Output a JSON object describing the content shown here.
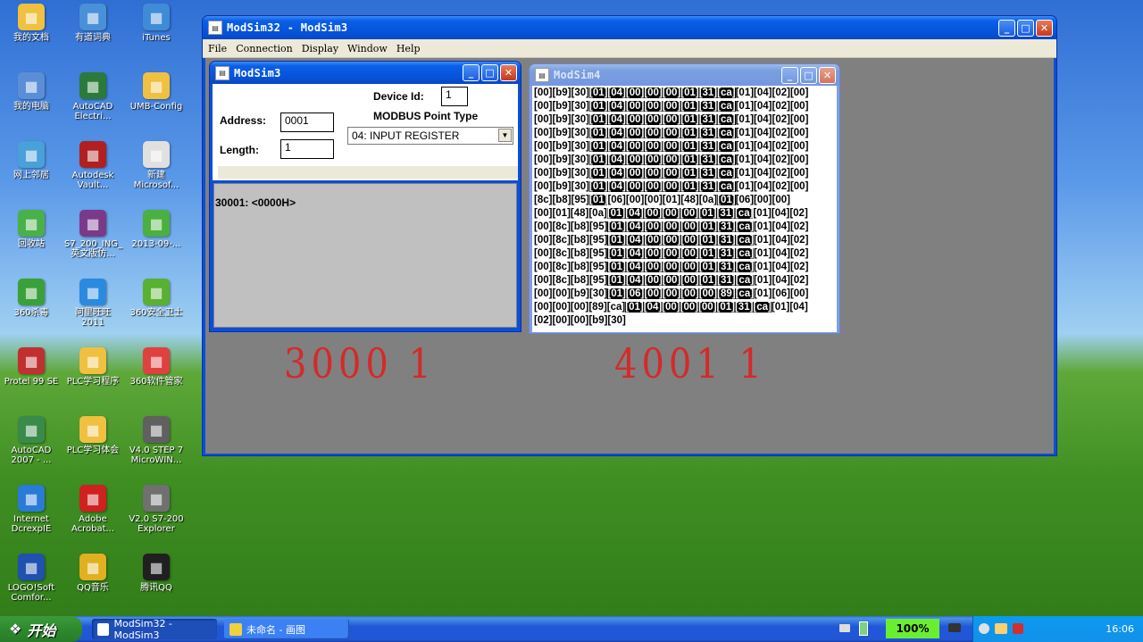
{
  "desktop": {
    "icons": [
      {
        "label": "我的文档",
        "icon": "folder-icon",
        "color": "#f0c040"
      },
      {
        "label": "有道词典",
        "icon": "dictionary-icon",
        "color": "#4a90d9"
      },
      {
        "label": "iTunes",
        "icon": "itunes-icon",
        "color": "#3f8bd8"
      },
      {
        "label": "我的电脑",
        "icon": "computer-icon",
        "color": "#5b8ed6"
      },
      {
        "label": "AutoCAD Electri...",
        "icon": "autocad-icon",
        "color": "#2b7a3a"
      },
      {
        "label": "UMB-Config",
        "icon": "folder-icon",
        "color": "#f0c040"
      },
      {
        "label": "网上邻居",
        "icon": "network-icon",
        "color": "#4aa0d8"
      },
      {
        "label": "Autodesk Vault...",
        "icon": "vault-icon",
        "color": "#b02020"
      },
      {
        "label": "新建 Microsof...",
        "icon": "document-icon",
        "color": "#e0e0e0"
      },
      {
        "label": "回收站",
        "icon": "recycle-bin-icon",
        "color": "#4ab04a"
      },
      {
        "label": "S7_200_ING_英文版仿...",
        "icon": "archive-icon",
        "color": "#7a3a8a"
      },
      {
        "label": "2013-09-...",
        "icon": "package-icon",
        "color": "#4ab040"
      },
      {
        "label": "360杀毒",
        "icon": "antivirus-icon",
        "color": "#3aa03a"
      },
      {
        "label": "阿里旺旺 2011",
        "icon": "chat-icon",
        "color": "#2a8adf"
      },
      {
        "label": "360安全卫士",
        "icon": "security-icon",
        "color": "#5ab030"
      },
      {
        "label": "Protel 99 SE",
        "icon": "protel-icon",
        "color": "#c03030"
      },
      {
        "label": "PLC学习程序",
        "icon": "folder-icon",
        "color": "#f0c040"
      },
      {
        "label": "360软件管家",
        "icon": "software-manager-icon",
        "color": "#e04040"
      },
      {
        "label": "AutoCAD 2007 - ...",
        "icon": "autocad-icon",
        "color": "#3a8a4a"
      },
      {
        "label": "PLC学习体会",
        "icon": "folder-icon",
        "color": "#f0c040"
      },
      {
        "label": "V4.0 STEP 7 MicroWIN...",
        "icon": "step7-icon",
        "color": "#606060"
      },
      {
        "label": "Internet DcrexpIE",
        "icon": "ie-icon",
        "color": "#2a7ad8"
      },
      {
        "label": "Adobe Acrobat...",
        "icon": "pdf-icon",
        "color": "#d02020"
      },
      {
        "label": "V2.0 S7-200 Explorer",
        "icon": "explorer-icon",
        "color": "#707070"
      },
      {
        "label": "LOGO!Soft Comfor...",
        "icon": "logo-icon",
        "color": "#2050b0"
      },
      {
        "label": "QQ音乐",
        "icon": "music-icon",
        "color": "#e0b020"
      },
      {
        "label": "腾讯QQ",
        "icon": "qq-icon",
        "color": "#202020"
      }
    ]
  },
  "main_window": {
    "title": "ModSim32 - ModSim3",
    "menu": [
      "File",
      "Connection",
      "Display",
      "Window",
      "Help"
    ]
  },
  "modsim3": {
    "title": "ModSim3",
    "device_id_label": "Device Id:",
    "device_id": "1",
    "address_label": "Address:",
    "address": "0001",
    "point_type_label": "MODBUS Point Type",
    "point_type": "04: INPUT REGISTER",
    "length_label": "Length:",
    "length": "1",
    "register_line": "30001: <0000H>"
  },
  "modsim4": {
    "title": "ModSim4",
    "rows": [
      [
        [
          "[00][b9][30]",
          false
        ],
        [
          "[01][04][00][00][00][01][31][ca]",
          true
        ],
        [
          "[01][04][02][00]",
          false
        ]
      ],
      [
        [
          "[00][b9][30]",
          false
        ],
        [
          "[01][04][00][00][00][01][31][ca]",
          true
        ],
        [
          "[01][04][02][00]",
          false
        ]
      ],
      [
        [
          "[00][b9][30]",
          false
        ],
        [
          "[01][04][00][00][00][01][31][ca]",
          true
        ],
        [
          "[01][04][02][00]",
          false
        ]
      ],
      [
        [
          "[00][b9][30]",
          false
        ],
        [
          "[01][04][00][00][00][01][31][ca]",
          true
        ],
        [
          "[01][04][02][00]",
          false
        ]
      ],
      [
        [
          "[00][b9][30]",
          false
        ],
        [
          "[01][04][00][00][00][01][31][ca]",
          true
        ],
        [
          "[01][04][02][00]",
          false
        ]
      ],
      [
        [
          "[00][b9][30]",
          false
        ],
        [
          "[01][04][00][00][00][01][31][ca]",
          true
        ],
        [
          "[01][04][02][00]",
          false
        ]
      ],
      [
        [
          "[00][b9][30]",
          false
        ],
        [
          "[01][04][00][00][00][01][31][ca]",
          true
        ],
        [
          "[01][04][02][00]",
          false
        ]
      ],
      [
        [
          "[00][b9][30]",
          false
        ],
        [
          "[01][04][00][00][00][01][31][ca]",
          true
        ],
        [
          "[01][04][02][00]",
          false
        ]
      ],
      [
        [
          "[8c][b8][95]",
          false
        ],
        [
          "[01]",
          true
        ],
        [
          "[06][00][00][01][48][0a]",
          false
        ],
        [
          "[01]",
          true
        ],
        [
          "[06][00][00]",
          false
        ]
      ],
      [
        [
          "[00][01][48][0a]",
          false
        ],
        [
          "[01][04][00][00][00][01][31][ca]",
          true
        ],
        [
          "[01][04][02]",
          false
        ]
      ],
      [
        [
          "[00][8c][b8][95]",
          false
        ],
        [
          "[01][04][00][00][00][01][31][ca]",
          true
        ],
        [
          "[01][04][02]",
          false
        ]
      ],
      [
        [
          "[00][8c][b8][95]",
          false
        ],
        [
          "[01][04][00][00][00][01][31][ca]",
          true
        ],
        [
          "[01][04][02]",
          false
        ]
      ],
      [
        [
          "[00][8c][b8][95]",
          false
        ],
        [
          "[01][04][00][00][00][01][31][ca]",
          true
        ],
        [
          "[01][04][02]",
          false
        ]
      ],
      [
        [
          "[00][8c][b8][95]",
          false
        ],
        [
          "[01][04][00][00][00][01][31][ca]",
          true
        ],
        [
          "[01][04][02]",
          false
        ]
      ],
      [
        [
          "[00][8c][b8][95]",
          false
        ],
        [
          "[01][04][00][00][00][01][31][ca]",
          true
        ],
        [
          "[01][04][02]",
          false
        ]
      ],
      [
        [
          "[00][00][b9][30]",
          false
        ],
        [
          "[01][06][00][00][00][00][89][ca]",
          true
        ],
        [
          "[01][06][00]",
          false
        ]
      ],
      [
        [
          "[00][00][00][89][ca]",
          false
        ],
        [
          "[01][04][00][00][00][01][31][ca]",
          true
        ],
        [
          "[01][04]",
          false
        ]
      ],
      [
        [
          "[02][00][00][b9][30]",
          false
        ]
      ]
    ]
  },
  "annotations": {
    "left": "3000 1",
    "right": "4001 1"
  },
  "taskbar": {
    "start_label": "开始",
    "tasks": [
      "ModSim32 - ModSim3",
      "未命名 - 画图"
    ],
    "battery": "100%",
    "clock": "16:06"
  }
}
